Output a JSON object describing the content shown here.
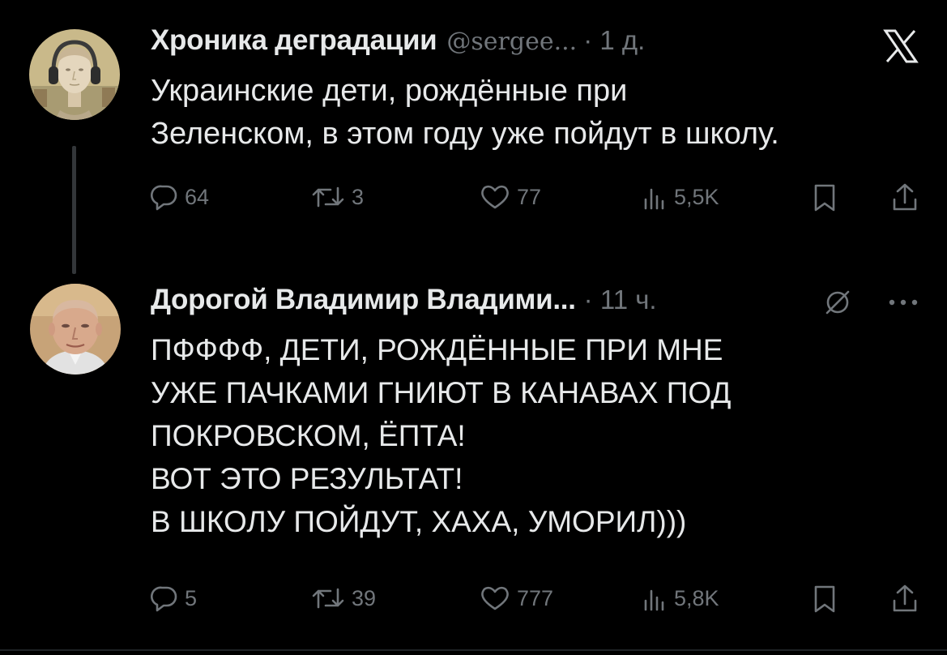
{
  "post1": {
    "author": "Хроника деградации",
    "handle": "@sergee...",
    "time": "· 1 д.",
    "lines": [
      "Украинские дети, рождённые при",
      "Зеленском, в этом году уже пойдут в школу."
    ],
    "replies": "64",
    "reposts": "3",
    "likes": "77",
    "views": "5,5K"
  },
  "post2": {
    "author": "Дорогой Владимир Владими...",
    "time": "· 11 ч.",
    "lines": [
      "ПФФФФ, ДЕТИ, РОЖДЁННЫЕ ПРИ МНЕ",
      "УЖЕ ПАЧКАМИ ГНИЮТ В КАНАВАХ ПОД",
      "ПОКРОВСКОМ, ЁПТА!",
      "ВОТ ЭТО РЕЗУЛЬТАТ!",
      "В ШКОЛУ ПОЙДУТ, ХАХА, УМОРИЛ)))"
    ],
    "replies": "5",
    "reposts": "39",
    "likes": "777",
    "views": "5,8K"
  },
  "icons": {
    "x_logo": "x-logo-icon",
    "reply": "reply-icon",
    "repost": "repost-icon",
    "like": "heart-icon",
    "views": "views-icon",
    "bookmark": "bookmark-icon",
    "share": "share-icon",
    "grok": "grok-icon",
    "more": "more-icon"
  },
  "colors": {
    "background": "#000000",
    "text": "#e7e9ea",
    "muted": "#71767b",
    "thread_line": "#333639"
  }
}
